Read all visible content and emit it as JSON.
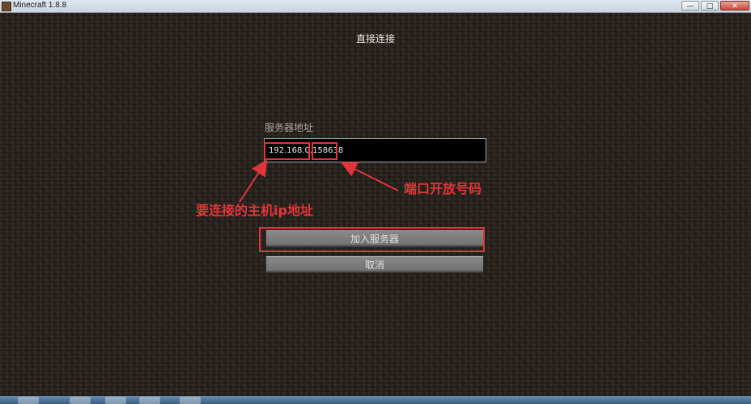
{
  "window": {
    "title": "Minecraft 1.8.8",
    "minimize": "—",
    "maximize": "□",
    "close": "✕"
  },
  "screen": {
    "title": "直接连接",
    "address_label": "服务器地址",
    "address_value": "192.168.0.158638",
    "join_button": "加入服务器",
    "cancel_button": "取消"
  },
  "annotations": {
    "host_label": "要连接的主机ip地址",
    "port_label": "端口开放号码",
    "color": "#e0353a"
  }
}
